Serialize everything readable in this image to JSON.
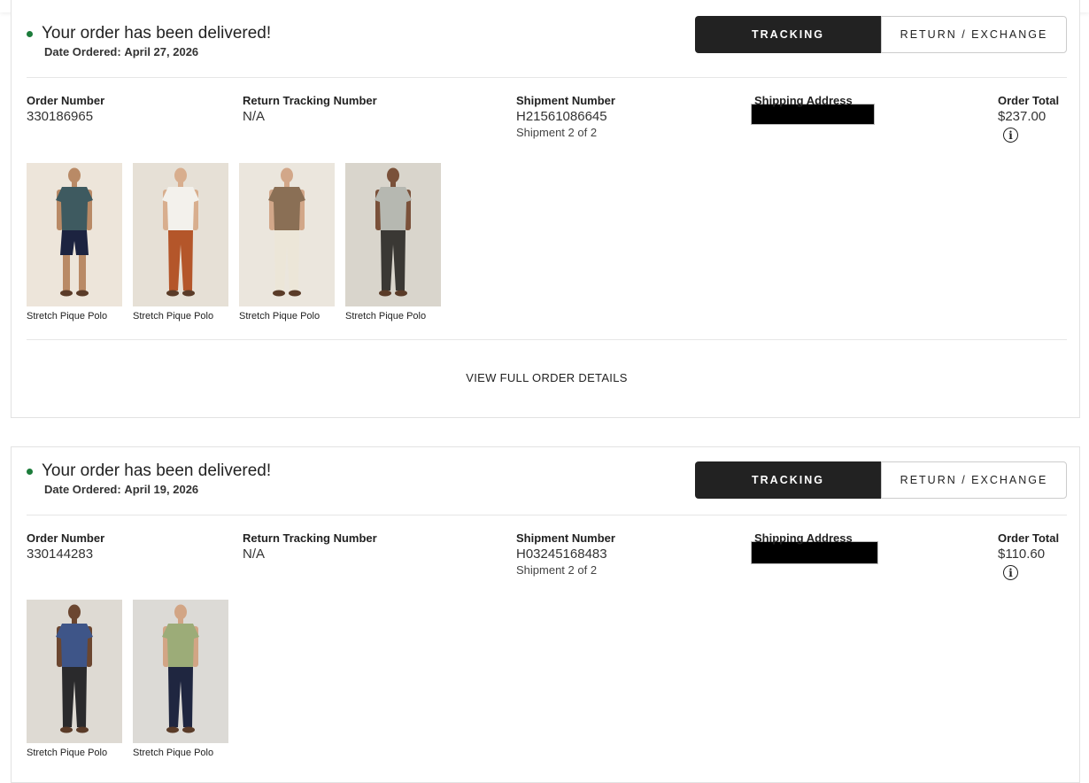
{
  "orders": [
    {
      "status": "Your order has been delivered!",
      "date_label": "Date Ordered:",
      "date_value": "April 27, 2026",
      "buttons": {
        "tracking": "TRACKING",
        "return": "RETURN / EXCHANGE"
      },
      "order_number": {
        "label": "Order Number",
        "value": "330186965"
      },
      "return_tracking": {
        "label": "Return Tracking Number",
        "value": "N/A"
      },
      "shipment": {
        "label": "Shipment Number",
        "value": "H21561086645",
        "sub": "Shipment 2 of 2"
      },
      "shipping_address": {
        "label": "Shipping Address"
      },
      "order_total": {
        "label": "Order Total",
        "value": "$237.00"
      },
      "products": [
        {
          "name": "Stretch Pique Polo",
          "bg": "#ede5da",
          "shirt": "#3e5a60",
          "pants": "#1c2340",
          "skin": "#b98a66",
          "shorts": true
        },
        {
          "name": "Stretch Pique Polo",
          "bg": "#e6e0d6",
          "shirt": "#f3f1ec",
          "pants": "#b4562a",
          "skin": "#d8ae8e",
          "shorts": false
        },
        {
          "name": "Stretch Pique Polo",
          "bg": "#ebe6dd",
          "shirt": "#8a6f55",
          "pants": "#ece6d8",
          "skin": "#d2a789",
          "shorts": false
        },
        {
          "name": "Stretch Pique Polo",
          "bg": "#d9d5cc",
          "shirt": "#b6b8b1",
          "pants": "#3a3834",
          "skin": "#7a513a",
          "shorts": false
        }
      ],
      "view_details": "VIEW FULL ORDER DETAILS"
    },
    {
      "status": "Your order has been delivered!",
      "date_label": "Date Ordered:",
      "date_value": "April 19, 2026",
      "buttons": {
        "tracking": "TRACKING",
        "return": "RETURN / EXCHANGE"
      },
      "order_number": {
        "label": "Order Number",
        "value": "330144283"
      },
      "return_tracking": {
        "label": "Return Tracking Number",
        "value": "N/A"
      },
      "shipment": {
        "label": "Shipment Number",
        "value": "H03245168483",
        "sub": "Shipment 2 of 2"
      },
      "shipping_address": {
        "label": "Shipping Address"
      },
      "order_total": {
        "label": "Order Total",
        "value": "$110.60"
      },
      "products": [
        {
          "name": "Stretch Pique Polo",
          "bg": "#dedad3",
          "shirt": "#3e5588",
          "pants": "#2a2a2c",
          "skin": "#6b4630",
          "shorts": false
        },
        {
          "name": "Stretch Pique Polo",
          "bg": "#dcdad6",
          "shirt": "#9cac78",
          "pants": "#1f2640",
          "skin": "#d2a585",
          "shorts": false
        }
      ]
    }
  ],
  "colors": {
    "accent_dark": "#222222",
    "status_dot": "#1c7c3b",
    "divider": "#e6e6e6"
  },
  "icons": {
    "info": "info-circle-icon",
    "status": "status-dot-icon"
  }
}
